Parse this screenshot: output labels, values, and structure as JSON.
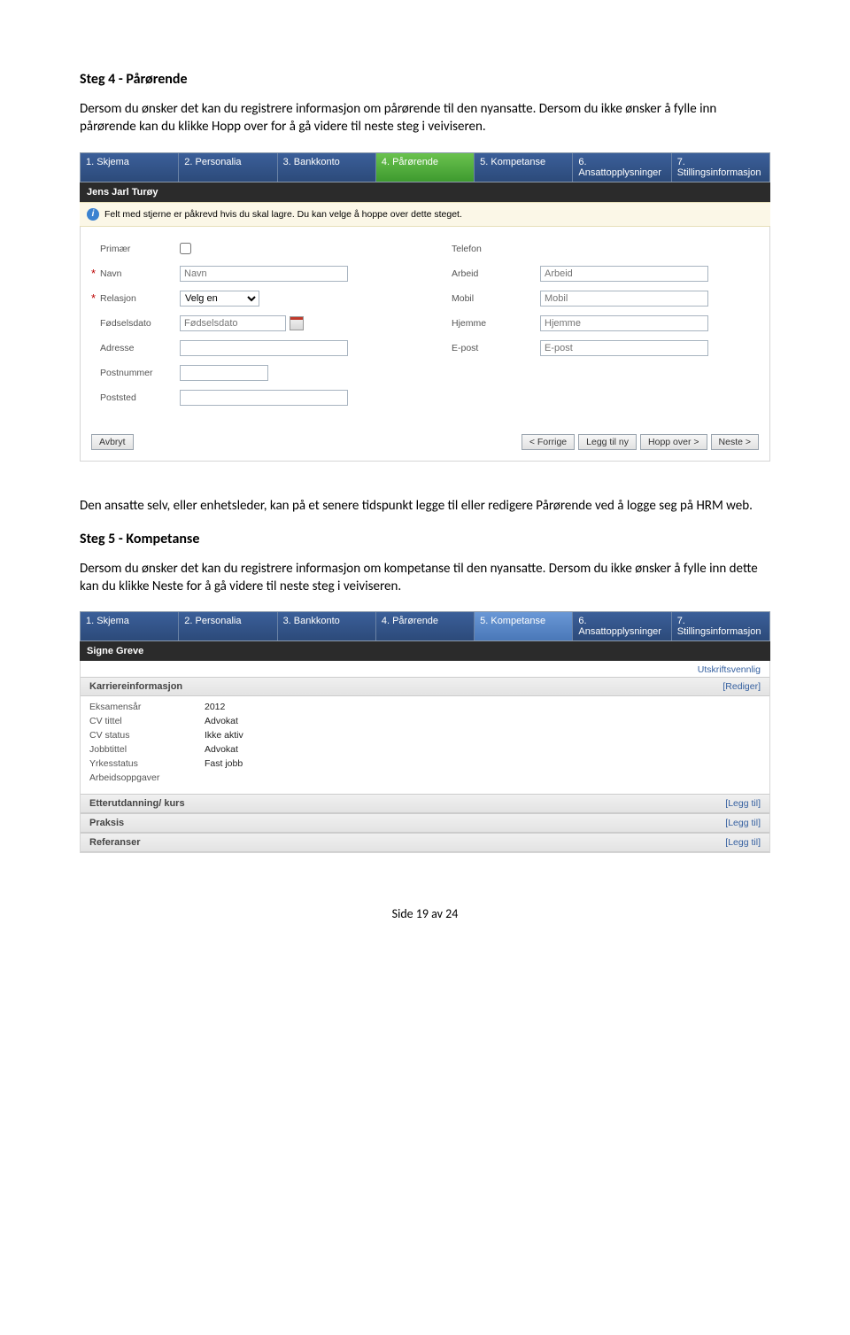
{
  "doc": {
    "step4_heading": "Steg 4 - Pårørende",
    "step4_para": "Dersom du ønsker det kan du registrere informasjon om pårørende til den nyansatte. Dersom du ikke ønsker å fylle inn pårørende kan du klikke Hopp over for å gå videre til neste steg i veiviseren.",
    "mid_para": "Den ansatte selv, eller enhetsleder, kan på et senere tidspunkt legge til eller redigere Pårørende ved å logge seg på HRM web.",
    "step5_heading": "Steg 5 - Kompetanse",
    "step5_para": "Dersom du ønsker det kan du registrere informasjon om kompetanse til den nyansatte. Dersom du ikke ønsker å fylle inn dette kan du klikke Neste for å gå videre til neste steg i veiviseren.",
    "footer": "Side 19 av 24"
  },
  "tabs": [
    "1. Skjema",
    "2. Personalia",
    "3. Bankkonto",
    "4. Pårørende",
    "5. Kompetanse",
    "6. Ansattopplysninger",
    "7. Stillingsinformasjon"
  ],
  "panel1": {
    "name": "Jens Jarl Turøy",
    "info": "Felt med stjerne er påkrevd hvis du skal lagre. Du kan velge å hoppe over dette steget.",
    "left": {
      "primaer": "Primær",
      "navn": "Navn",
      "navn_ph": "Navn",
      "relasjon": "Relasjon",
      "relasjon_value": "Velg en",
      "fodselsdato": "Fødselsdato",
      "fodselsdato_ph": "Fødselsdato",
      "adresse": "Adresse",
      "postnummer": "Postnummer",
      "poststed": "Poststed"
    },
    "right": {
      "telefon": "Telefon",
      "arbeid": "Arbeid",
      "arbeid_ph": "Arbeid",
      "mobil": "Mobil",
      "mobil_ph": "Mobil",
      "hjemme": "Hjemme",
      "hjemme_ph": "Hjemme",
      "epost": "E-post",
      "epost_ph": "E-post"
    },
    "buttons": {
      "avbryt": "Avbryt",
      "forrige": "< Forrige",
      "leggtil": "Legg til ny",
      "hoppover": "Hopp over >",
      "neste": "Neste >"
    }
  },
  "panel2": {
    "name": "Signe Greve",
    "utskrift": "Utskriftsvennlig",
    "sections": {
      "karriere": {
        "title": "Karriereinformasjon",
        "link": "[Rediger]",
        "rows": [
          {
            "k": "Eksamensår",
            "v": "2012"
          },
          {
            "k": "CV tittel",
            "v": "Advokat"
          },
          {
            "k": "CV status",
            "v": "Ikke aktiv"
          },
          {
            "k": "Jobbtittel",
            "v": "Advokat"
          },
          {
            "k": "Yrkesstatus",
            "v": "Fast jobb"
          },
          {
            "k": "Arbeidsoppgaver",
            "v": ""
          }
        ]
      },
      "etter": {
        "title": "Etterutdanning/ kurs",
        "link": "[Legg til]"
      },
      "praksis": {
        "title": "Praksis",
        "link": "[Legg til]"
      },
      "referanser": {
        "title": "Referanser",
        "link": "[Legg til]"
      }
    }
  }
}
